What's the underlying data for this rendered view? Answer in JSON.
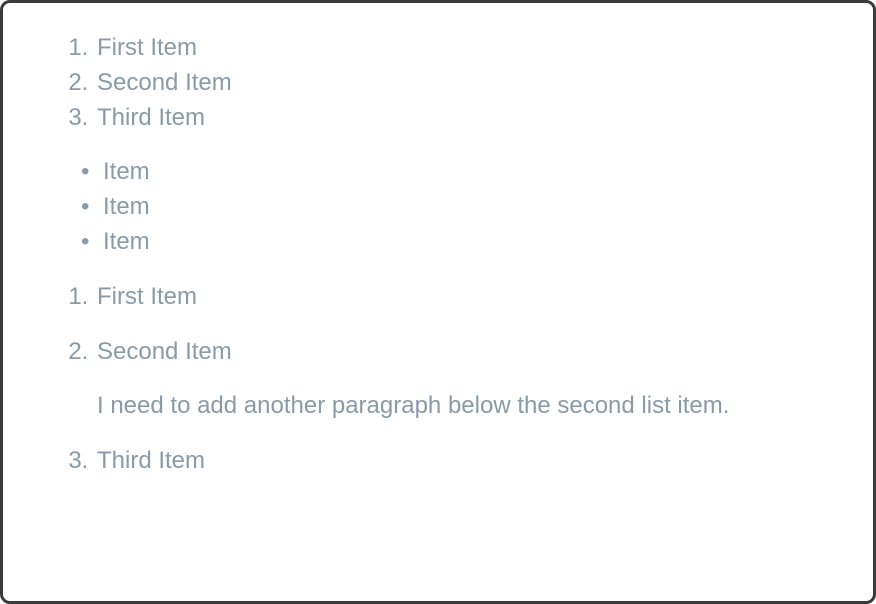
{
  "ordered_list_1": {
    "items": [
      "First Item",
      "Second Item",
      "Third Item"
    ]
  },
  "unordered_list": {
    "items": [
      "Item",
      "Item",
      "Item"
    ]
  },
  "ordered_list_2": {
    "items": [
      {
        "label": "First Item"
      },
      {
        "label": "Second Item",
        "paragraph": "I need to add another paragraph below the second list item."
      },
      {
        "label": "Third Item"
      }
    ]
  }
}
